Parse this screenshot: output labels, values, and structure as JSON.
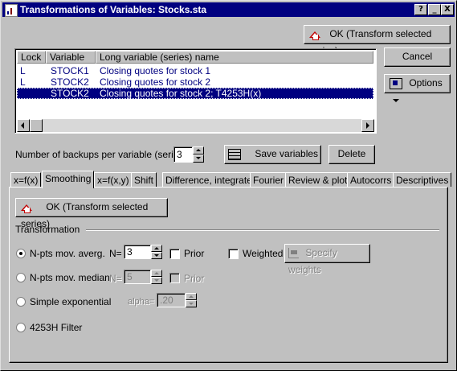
{
  "window": {
    "title": "Transformations of Variables: Stocks.sta",
    "help": "?",
    "minimize": "_",
    "close": "X"
  },
  "buttons": {
    "ok_top": "OK (Transform selected series)",
    "cancel": "Cancel",
    "options": "Options",
    "save_variables": "Save variables",
    "delete": "Delete",
    "ok_panel": "OK (Transform selected series)",
    "specify_weights": "Specify weights"
  },
  "table": {
    "headers": [
      "Lock",
      "Variable",
      "Long variable (series) name"
    ],
    "rows": [
      {
        "lock": "L",
        "variable": "STOCK1",
        "name": "Closing quotes for stock 1"
      },
      {
        "lock": "L",
        "variable": "STOCK2",
        "name": "Closing quotes for stock 2"
      },
      {
        "lock": "",
        "variable": "STOCK2",
        "name": "Closing quotes for stock 2; T4253H(x)"
      }
    ]
  },
  "backups": {
    "label": "Number of backups per variable (series):",
    "value": "3"
  },
  "tabs": [
    "x=f(x)",
    "Smoothing",
    "x=f(x,y)",
    "Shift",
    "Difference, integrate",
    "Fourier",
    "Review & plot",
    "Autocorrs",
    "Descriptives"
  ],
  "active_tab": "Smoothing",
  "transformation": {
    "group_label": "Transformation",
    "options": [
      {
        "label": "N-pts mov. averg.",
        "selected": true
      },
      {
        "label": "N-pts mov. median",
        "selected": false
      },
      {
        "label": "Simple exponential",
        "selected": false
      },
      {
        "label": "4253H Filter",
        "selected": false
      }
    ],
    "n_label": "N=",
    "n_value": "3",
    "n2_label": "N=",
    "n2_value": "5",
    "prior_label": "Prior",
    "prior2_label": "Prior",
    "weighted_label": "Weighted",
    "alpha_label": "alpha=",
    "alpha_value": ".20"
  },
  "colors": {
    "titlebar": "#000080",
    "selection": "#000080",
    "face": "#c0c0c0"
  }
}
